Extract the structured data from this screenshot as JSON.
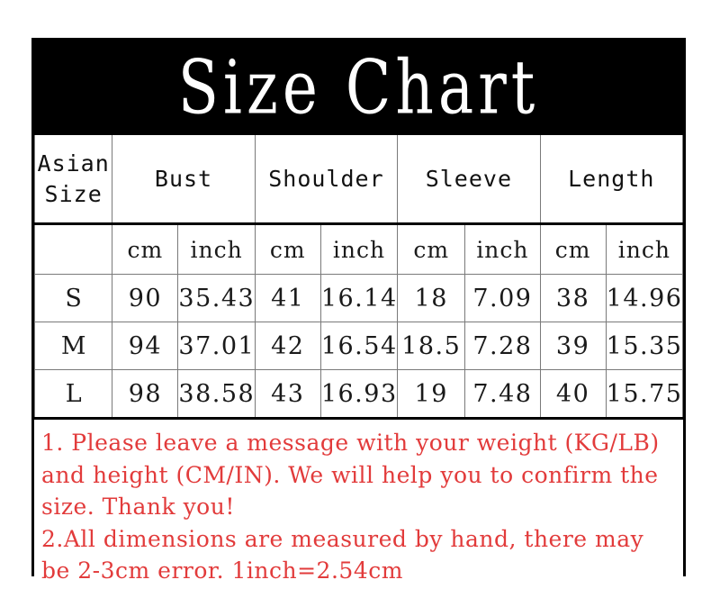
{
  "title": "Size Chart",
  "table": {
    "headers": [
      {
        "name": "asian-size",
        "label": "Asian\nSize"
      },
      {
        "name": "bust",
        "label": "Bust"
      },
      {
        "name": "shoulder",
        "label": "Shoulder"
      },
      {
        "name": "sleeve",
        "label": "Sleeve"
      },
      {
        "name": "length",
        "label": "Length"
      }
    ],
    "units_row": {
      "blank": "",
      "units": [
        "cm",
        "inch",
        "cm",
        "inch",
        "cm",
        "inch",
        "cm",
        "inch"
      ]
    },
    "rows": [
      {
        "size": "S",
        "bust_cm": "90",
        "bust_inch": "35.43",
        "shoulder_cm": "41",
        "shoulder_inch": "16.14",
        "sleeve_cm": "18",
        "sleeve_inch": "7.09",
        "length_cm": "38",
        "length_inch": "14.96"
      },
      {
        "size": "M",
        "bust_cm": "94",
        "bust_inch": "37.01",
        "shoulder_cm": "42",
        "shoulder_inch": "16.54",
        "sleeve_cm": "18.5",
        "sleeve_inch": "7.28",
        "length_cm": "39",
        "length_inch": "15.35"
      },
      {
        "size": "L",
        "bust_cm": "98",
        "bust_inch": "38.58",
        "shoulder_cm": "43",
        "shoulder_inch": "16.93",
        "sleeve_cm": "19",
        "sleeve_inch": "7.48",
        "length_cm": "40",
        "length_inch": "15.75"
      }
    ]
  },
  "notes": {
    "note1": "1. Please leave a message with your weight (KG/LB) and height (CM/IN). We will help you to confirm the size. Thank you!",
    "note2": "2.All dimensions are measured by hand, there may be 2-3cm error. 1inch=2.54cm"
  },
  "colors": {
    "title_band": "#000000",
    "title_text": "#ffffff",
    "note_text": "#e23b3b",
    "grid_thick": "#000000",
    "grid_thin": "#7a7a7a"
  }
}
